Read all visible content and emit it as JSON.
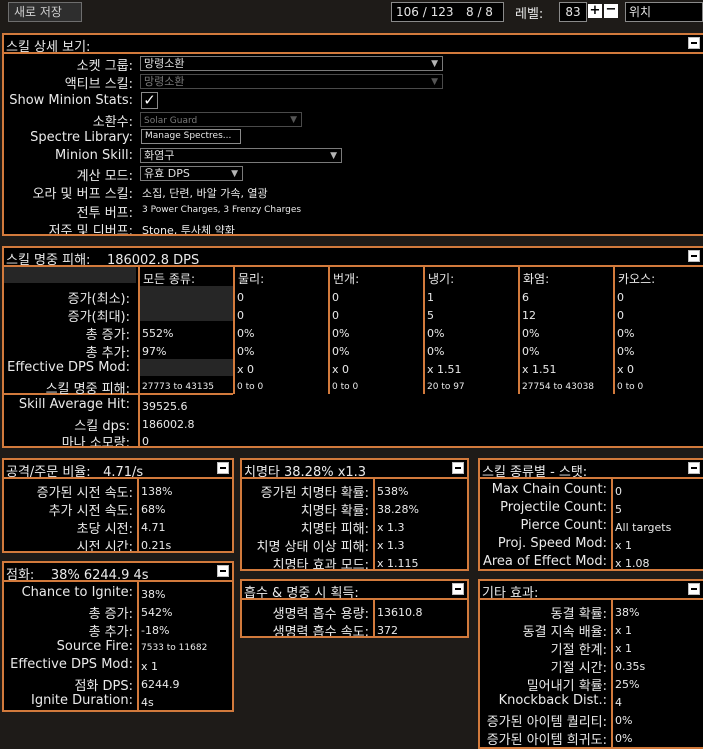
{
  "topbar": {
    "save_label": "새로 저장",
    "points": "106 / 123",
    "ascend": "8 / 8",
    "level_label": "레벨:",
    "level": "83",
    "location": "위치"
  },
  "skill_detail": {
    "title": "스킬 상세 보기:",
    "rows": [
      {
        "label": "소켓 그룹:",
        "value": "망령소환"
      },
      {
        "label": "액티브 스킬:",
        "value": "망령소환"
      },
      {
        "label": "Show Minion Stats:",
        "value": ""
      },
      {
        "label": "소환수:",
        "value": "Solar Guard"
      },
      {
        "label": "Spectre Library:",
        "value": "Manage Spectres..."
      },
      {
        "label": "Minion Skill:",
        "value": "화염구"
      },
      {
        "label": "계산 모드:",
        "value": "유효 DPS"
      },
      {
        "label": "오라 및 버프 스킬:",
        "value": "소집, 단련, 바알 가속, 열광"
      },
      {
        "label": "전투 버프:",
        "value": "3 Power Charges, 3 Frenzy Charges"
      },
      {
        "label": "저주 및 디버프:",
        "value": "Stone, 투사체 약화"
      }
    ]
  },
  "hit_damage": {
    "title": "스킬 명중 피해:",
    "title_value": "186002.8 DPS",
    "headers": [
      "모든 종류:",
      "물리:",
      "번개:",
      "냉기:",
      "화염:",
      "카오스:"
    ],
    "rows": [
      {
        "label": "증가(최소):",
        "cells": [
          "",
          "0",
          "0",
          "1",
          "6",
          "0"
        ]
      },
      {
        "label": "증가(최대):",
        "cells": [
          "",
          "0",
          "0",
          "5",
          "12",
          "0"
        ]
      },
      {
        "label": "총 증가:",
        "cells": [
          "552%",
          "0%",
          "0%",
          "0%",
          "0%",
          "0%"
        ]
      },
      {
        "label": "총 추가:",
        "cells": [
          "97%",
          "0%",
          "0%",
          "0%",
          "0%",
          "0%"
        ]
      },
      {
        "label": "Effective DPS Mod:",
        "cells": [
          "",
          "x 0",
          "x 0",
          "x 1.51",
          "x 1.51",
          "x 0"
        ]
      },
      {
        "label": "스킬 명중 피해:",
        "cells": [
          "27773 to 43135",
          "0 to 0",
          "0 to 0",
          "20 to 97",
          "27754 to 43038",
          "0 to 0"
        ]
      }
    ],
    "summary": [
      {
        "label": "Skill Average Hit:",
        "value": "39525.6"
      },
      {
        "label": "스킬 dps:",
        "value": "186002.8"
      },
      {
        "label": "마나 소모량:",
        "value": "0"
      }
    ]
  },
  "attack_speed": {
    "title": "공격/주문 비율:",
    "title_value": "4.71/s",
    "rows": [
      {
        "label": "증가된 시전 속도:",
        "value": "138%"
      },
      {
        "label": "추가 시전 속도:",
        "value": "68%"
      },
      {
        "label": "초당 시전:",
        "value": "4.71"
      },
      {
        "label": "시전 시간:",
        "value": "0.21s"
      }
    ]
  },
  "crit": {
    "title": "치명타 38.28% x1.3",
    "rows": [
      {
        "label": "증가된 치명타 확률:",
        "value": "538%"
      },
      {
        "label": "치명타 확률:",
        "value": "38.28%"
      },
      {
        "label": "치명타 피해:",
        "value": "x 1.3"
      },
      {
        "label": "치명 상태 이상 피해:",
        "value": "x 1.3"
      },
      {
        "label": "치명타 효과 모드:",
        "value": "x 1.115"
      }
    ]
  },
  "skill_type": {
    "title": "스킬 종류별 - 스탯:",
    "rows": [
      {
        "label": "Max Chain Count:",
        "value": "0"
      },
      {
        "label": "Projectile Count:",
        "value": "5"
      },
      {
        "label": "Pierce Count:",
        "value": "All targets"
      },
      {
        "label": "Proj. Speed Mod:",
        "value": "x 1"
      },
      {
        "label": "Area of Effect Mod:",
        "value": "x 1.08"
      }
    ]
  },
  "ignite": {
    "title": "점화:",
    "title_value": "38% 6244.9 4s",
    "rows": [
      {
        "label": "Chance to Ignite:",
        "value": "38%"
      },
      {
        "label": "총 증가:",
        "value": "542%"
      },
      {
        "label": "총 추가:",
        "value": "-18%"
      },
      {
        "label": "Source Fire:",
        "value": "7533 to 11682"
      },
      {
        "label": "Effective DPS Mod:",
        "value": "x 1"
      },
      {
        "label": "점화 DPS:",
        "value": "6244.9"
      },
      {
        "label": "Ignite Duration:",
        "value": "4s"
      }
    ]
  },
  "leech": {
    "title": "흡수 & 명중 시 획득:",
    "rows": [
      {
        "label": "생명력 흡수 용량:",
        "value": "13610.8"
      },
      {
        "label": "생명력 흡수 속도:",
        "value": "372"
      }
    ]
  },
  "other": {
    "title": "기타 효과:",
    "rows": [
      {
        "label": "동결 확률:",
        "value": "38%"
      },
      {
        "label": "동결 지속 배율:",
        "value": "x 1"
      },
      {
        "label": "기절 한계:",
        "value": "x 1"
      },
      {
        "label": "기절 시간:",
        "value": "0.35s"
      },
      {
        "label": "밀어내기 확률:",
        "value": "25%"
      },
      {
        "label": "Knockback Dist.:",
        "value": "4"
      },
      {
        "label": "증가된 아이템 퀄리티:",
        "value": "0%"
      },
      {
        "label": "증가된 아이템 희귀도:",
        "value": "0%"
      }
    ]
  }
}
